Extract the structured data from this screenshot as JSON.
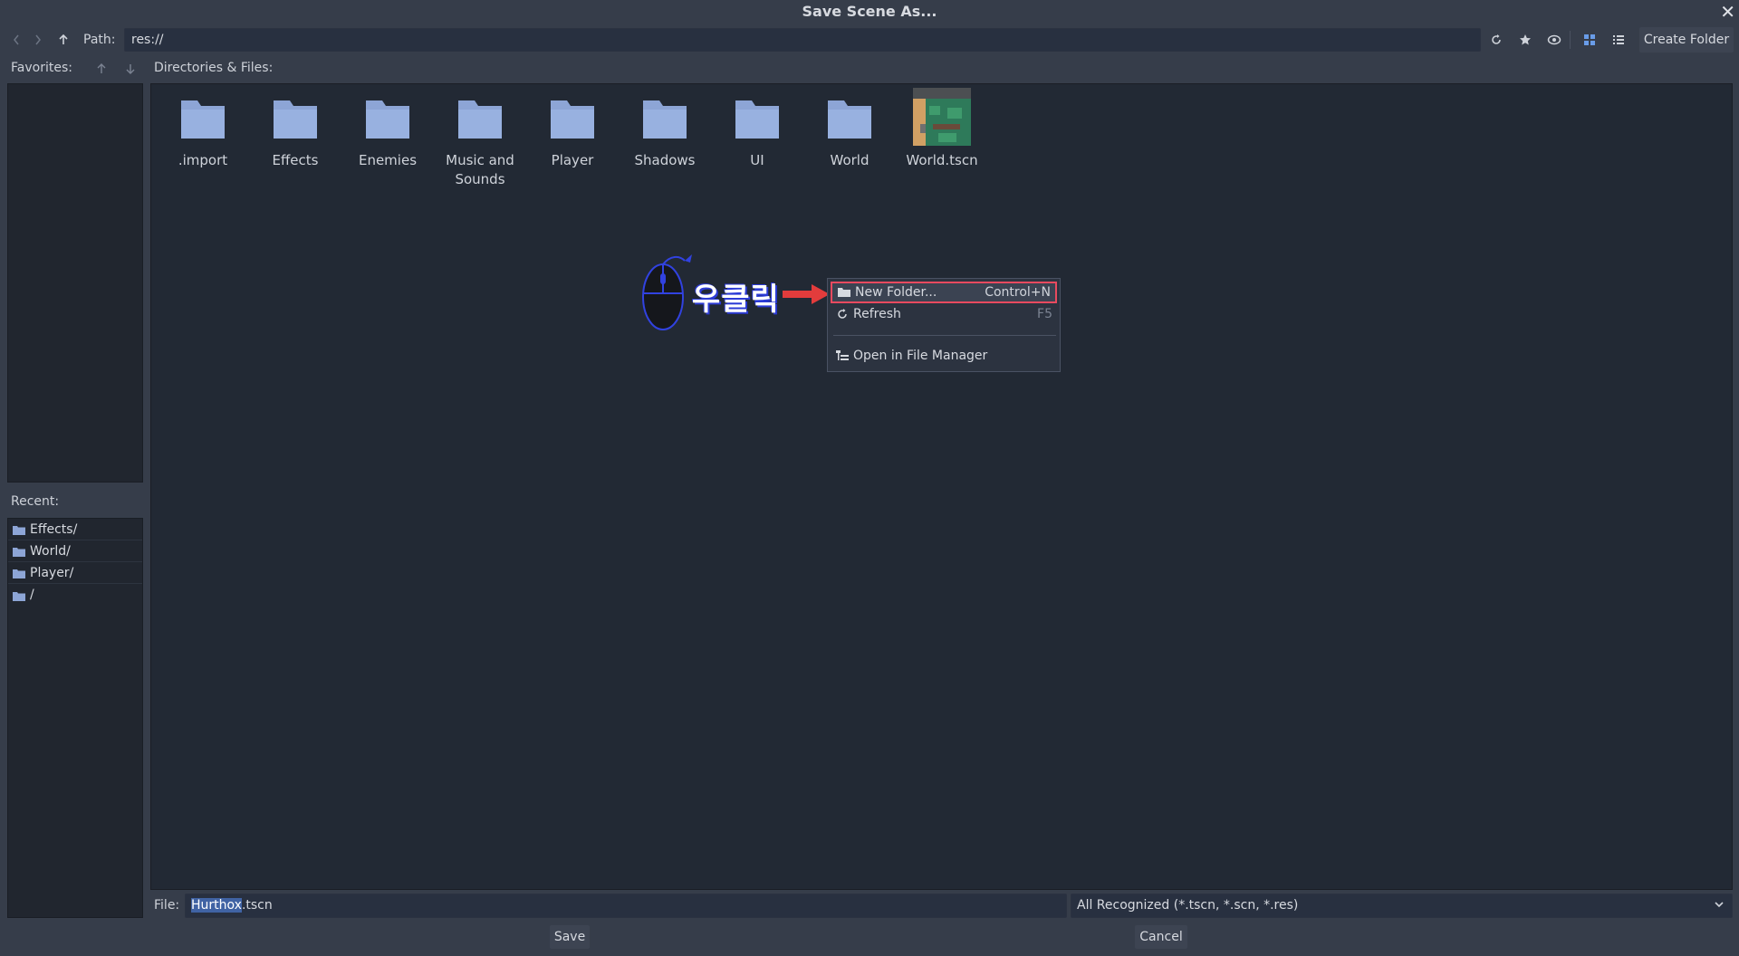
{
  "window": {
    "title": "Save Scene As...",
    "close_glyph": "✕"
  },
  "toolbar": {
    "path_label": "Path:",
    "path_value": "res://",
    "create_folder_label": "Create Folder"
  },
  "favorites": {
    "label": "Favorites:"
  },
  "recent": {
    "label": "Recent:",
    "items": [
      "Effects/",
      "World/",
      "Player/",
      "/"
    ]
  },
  "files": {
    "label": "Directories & Files:",
    "items": [
      {
        "name": ".import",
        "type": "folder"
      },
      {
        "name": "Effects",
        "type": "folder"
      },
      {
        "name": "Enemies",
        "type": "folder"
      },
      {
        "name": "Music and Sounds",
        "type": "folder"
      },
      {
        "name": "Player",
        "type": "folder"
      },
      {
        "name": "Shadows",
        "type": "folder"
      },
      {
        "name": "UI",
        "type": "folder"
      },
      {
        "name": "World",
        "type": "folder"
      },
      {
        "name": "World.tscn",
        "type": "scene"
      }
    ]
  },
  "annotation": {
    "text": "우클릭"
  },
  "context_menu": {
    "items": [
      {
        "label": "New Folder...",
        "shortcut": "Control+N",
        "icon": "folder-icon",
        "highlighted": true
      },
      {
        "label": "Refresh",
        "shortcut": "F5",
        "icon": "reload-icon"
      },
      {
        "label": "Open in File Manager",
        "shortcut": "",
        "icon": "filesystem-icon"
      }
    ]
  },
  "bottom": {
    "file_label": "File:",
    "file_name_selected": "Hurthox",
    "file_name_rest": ".tscn",
    "filter": "All Recognized (*.tscn, *.scn, *.res)",
    "save_label": "Save",
    "cancel_label": "Cancel"
  },
  "colors": {
    "accent": "#699ce8",
    "folder": "#8da5d6",
    "highlight_border": "#e84a5f",
    "background": "#363d4a",
    "panel": "#222934"
  }
}
